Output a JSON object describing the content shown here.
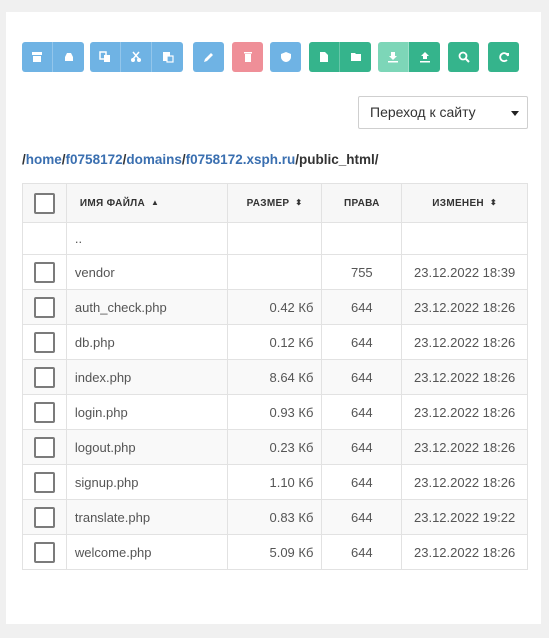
{
  "toolbar": {
    "icons": [
      "archive-icon",
      "drive-icon",
      "copy-icon",
      "cut-icon",
      "paste-icon",
      "pencil-icon",
      "trash-icon",
      "shield-icon",
      "new-file-icon",
      "new-folder-icon",
      "download-icon",
      "upload-icon",
      "search-icon",
      "refresh-icon"
    ]
  },
  "site_select": {
    "value": "Переход к сайту"
  },
  "breadcrumb": {
    "segments": [
      "home",
      "f0758172",
      "domains",
      "f0758172.xsph.ru"
    ],
    "current": "public_html",
    "separator": "/"
  },
  "table": {
    "headers": {
      "name": "Имя файла",
      "size": "Размер",
      "perms": "Права",
      "modified": "Изменен"
    },
    "updir": "..",
    "rows": [
      {
        "name": "vendor",
        "size": "",
        "perms": "755",
        "modified": "23.12.2022 18:39"
      },
      {
        "name": "auth_check.php",
        "size": "0.42 Кб",
        "perms": "644",
        "modified": "23.12.2022 18:26"
      },
      {
        "name": "db.php",
        "size": "0.12 Кб",
        "perms": "644",
        "modified": "23.12.2022 18:26"
      },
      {
        "name": "index.php",
        "size": "8.64 Кб",
        "perms": "644",
        "modified": "23.12.2022 18:26"
      },
      {
        "name": "login.php",
        "size": "0.93 Кб",
        "perms": "644",
        "modified": "23.12.2022 18:26"
      },
      {
        "name": "logout.php",
        "size": "0.23 Кб",
        "perms": "644",
        "modified": "23.12.2022 18:26"
      },
      {
        "name": "signup.php",
        "size": "1.10 Кб",
        "perms": "644",
        "modified": "23.12.2022 18:26"
      },
      {
        "name": "translate.php",
        "size": "0.83 Кб",
        "perms": "644",
        "modified": "23.12.2022 19:22"
      },
      {
        "name": "welcome.php",
        "size": "5.09 Кб",
        "perms": "644",
        "modified": "23.12.2022 18:26"
      }
    ]
  },
  "colors": {
    "blue": "#6fb3e4",
    "pink": "#ef8f98",
    "green": "#35b48c",
    "light_green": "#7dd6b8",
    "link": "#4a79b3"
  }
}
